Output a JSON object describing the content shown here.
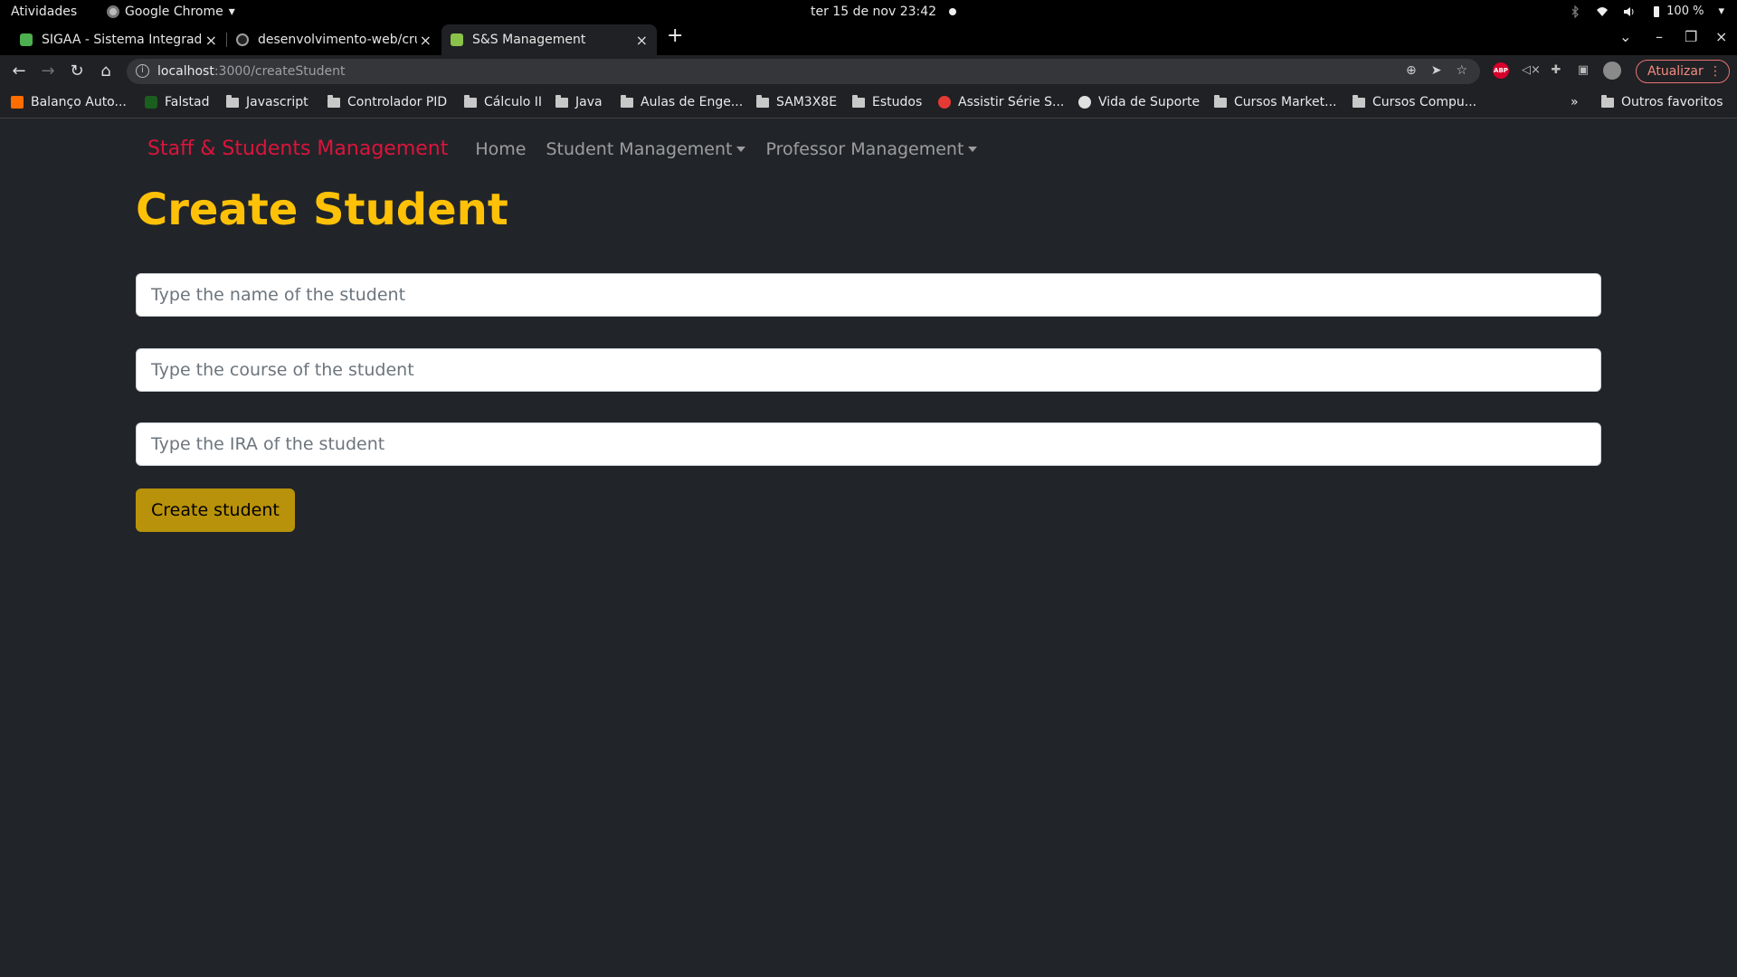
{
  "os_bar": {
    "activities": "Atividades",
    "app_name": "Google Chrome",
    "app_caret": "▾",
    "clock": "ter 15 de nov  23:42",
    "battery": "100 %"
  },
  "tabs": [
    {
      "title": "SIGAA - Sistema Integrado",
      "close": "×",
      "favicon_color": "#4caf50"
    },
    {
      "title": "desenvolvimento-web/crud",
      "close": "×",
      "favicon_color": "#9e9e9e"
    },
    {
      "title": "S&S Management",
      "close": "×",
      "favicon_color": "#8bc34a"
    }
  ],
  "new_tab": "+",
  "window_controls": {
    "list": "⌄",
    "minimize": "–",
    "restore": "❐",
    "close": "×"
  },
  "toolbar": {
    "back": "←",
    "forward": "→",
    "reload": "↻",
    "home": "⌂",
    "url_host": "localhost",
    "url_path": ":3000/createStudent",
    "update_label": "Atualizar",
    "kebab": "⋮"
  },
  "bookmarks": [
    {
      "label": "Balanço Auto...",
      "icon": "hex-icon",
      "color": "#ff6d00"
    },
    {
      "label": "Falstad",
      "icon": "circuit-icon",
      "color": "#1b5e20"
    },
    {
      "label": "Javascript",
      "icon": "folder-icon"
    },
    {
      "label": "Controlador PID",
      "icon": "folder-icon"
    },
    {
      "label": "Cálculo II",
      "icon": "folder-icon"
    },
    {
      "label": "Java",
      "icon": "folder-icon"
    },
    {
      "label": "Aulas de Enge...",
      "icon": "folder-icon"
    },
    {
      "label": "SAM3X8E",
      "icon": "folder-icon"
    },
    {
      "label": "Estudos",
      "icon": "folder-icon"
    },
    {
      "label": "Assistir Série S...",
      "icon": "play-icon",
      "color": "#e53935"
    },
    {
      "label": "Vida de Suporte",
      "icon": "skull-icon",
      "color": "#e0e0e0"
    },
    {
      "label": "Cursos Market...",
      "icon": "folder-icon"
    },
    {
      "label": "Cursos Compu...",
      "icon": "folder-icon"
    }
  ],
  "bookmarks_overflow": "»",
  "bookmarks_other": "Outros favoritos",
  "app": {
    "brand": "Staff & Students Management",
    "nav": {
      "home": "Home",
      "student_mgmt": "Student Management",
      "professor_mgmt": "Professor Management"
    },
    "title": "Create Student",
    "inputs": {
      "name_placeholder": "Type the name of the student",
      "course_placeholder": "Type the course of the student",
      "ira_placeholder": "Type the IRA of the student"
    },
    "submit_label": "Create student",
    "colors": {
      "brand": "#dc143c",
      "title": "#ffc107",
      "button": "#b8920a",
      "background": "#212529"
    }
  }
}
